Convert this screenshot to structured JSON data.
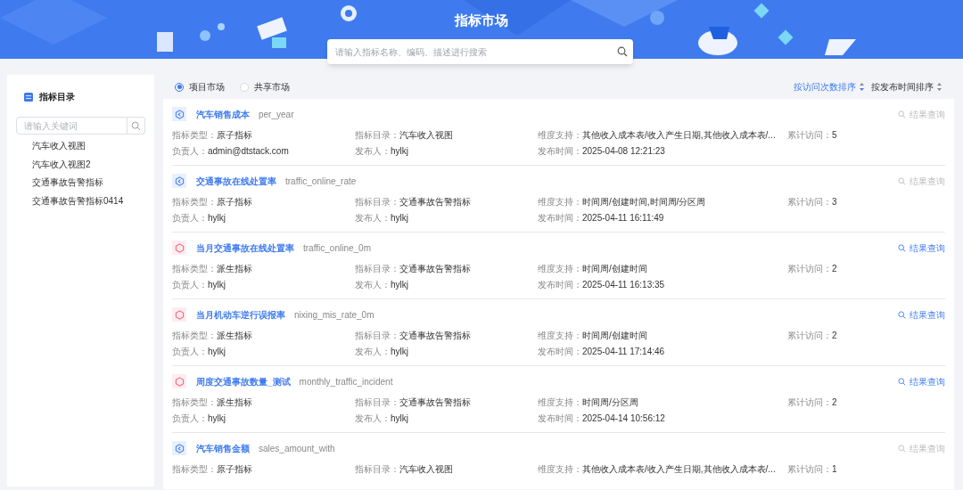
{
  "header": {
    "title": "指标市场",
    "search": {
      "placeholder": "请输入指标名称、编码、描述进行搜索"
    }
  },
  "sidebar": {
    "title": "指标目录",
    "search": {
      "placeholder": "请输入关键词"
    },
    "items": [
      {
        "label": "汽车收入视图"
      },
      {
        "label": "汽车收入视图2"
      },
      {
        "label": "交通事故告警指标"
      },
      {
        "label": "交通事故告警指标0414"
      }
    ]
  },
  "market_tabs": [
    {
      "label": "项目市场",
      "selected": true
    },
    {
      "label": "共享市场",
      "selected": false
    }
  ],
  "sort_options": [
    {
      "label": "按访问次数排序",
      "selected": true
    },
    {
      "label": "按发布时间排序",
      "selected": false
    }
  ],
  "metrics": [
    {
      "kind": "atomic",
      "name": "汽车销售成本",
      "code": "per_year",
      "query": {
        "label": "结果查询",
        "disabled": true
      },
      "fields": [
        {
          "label": "指标类型：",
          "value": "原子指标"
        },
        {
          "label": "指标目录：",
          "value": "汽车收入视图"
        },
        {
          "label": "维度支持：",
          "value": "其他收入成本表/收入产生日期,其他收入成本表/..."
        },
        {
          "label": "累计访问：",
          "value": "5"
        },
        {
          "label": "负责人：",
          "value": "admin@dtstack.com"
        },
        {
          "label": "发布人：",
          "value": "hylkj"
        },
        {
          "label": "发布时间：",
          "value": "2025-04-08 12:21:23"
        }
      ]
    },
    {
      "kind": "atomic",
      "name": "交通事故在线处置率",
      "code": "traffic_online_rate",
      "query": {
        "label": "结果查询",
        "disabled": true
      },
      "fields": [
        {
          "label": "指标类型：",
          "value": "原子指标"
        },
        {
          "label": "指标目录：",
          "value": "交通事故告警指标"
        },
        {
          "label": "维度支持：",
          "value": "时间周/创建时间,时间周/分区周"
        },
        {
          "label": "累计访问：",
          "value": "3"
        },
        {
          "label": "负责人：",
          "value": "hylkj"
        },
        {
          "label": "发布人：",
          "value": "hylkj"
        },
        {
          "label": "发布时间：",
          "value": "2025-04-11 16:11:49"
        }
      ]
    },
    {
      "kind": "derived",
      "name": "当月交通事故在线处置率",
      "code": "traffic_online_0m",
      "query": {
        "label": "结果查询",
        "disabled": false
      },
      "fields": [
        {
          "label": "指标类型：",
          "value": "派生指标"
        },
        {
          "label": "指标目录：",
          "value": "交通事故告警指标"
        },
        {
          "label": "维度支持：",
          "value": "时间周/创建时间"
        },
        {
          "label": "累计访问：",
          "value": "2"
        },
        {
          "label": "负责人：",
          "value": "hylkj"
        },
        {
          "label": "发布人：",
          "value": "hylkj"
        },
        {
          "label": "发布时间：",
          "value": "2025-04-11 16:13:35"
        }
      ]
    },
    {
      "kind": "derived",
      "name": "当月机动车逆行误报率",
      "code": "nixing_mis_rate_0m",
      "query": {
        "label": "结果查询",
        "disabled": false
      },
      "fields": [
        {
          "label": "指标类型：",
          "value": "派生指标"
        },
        {
          "label": "指标目录：",
          "value": "交通事故告警指标"
        },
        {
          "label": "维度支持：",
          "value": "时间周/创建时间"
        },
        {
          "label": "累计访问：",
          "value": "2"
        },
        {
          "label": "负责人：",
          "value": "hylkj"
        },
        {
          "label": "发布人：",
          "value": "hylkj"
        },
        {
          "label": "发布时间：",
          "value": "2025-04-11 17:14:46"
        }
      ]
    },
    {
      "kind": "derived",
      "name": "周度交通事故数量_测试",
      "code": "monthly_traffic_incident",
      "query": {
        "label": "结果查询",
        "disabled": false
      },
      "fields": [
        {
          "label": "指标类型：",
          "value": "派生指标"
        },
        {
          "label": "指标目录：",
          "value": "交通事故告警指标"
        },
        {
          "label": "维度支持：",
          "value": "时间周/分区周"
        },
        {
          "label": "累计访问：",
          "value": "2"
        },
        {
          "label": "负责人：",
          "value": "hylkj"
        },
        {
          "label": "发布人：",
          "value": "hylkj"
        },
        {
          "label": "发布时间：",
          "value": "2025-04-14 10:56:12"
        }
      ]
    },
    {
      "kind": "atomic",
      "name": "汽车销售金额",
      "code": "sales_amount_with",
      "query": {
        "label": "结果查询",
        "disabled": true
      },
      "fields": [
        {
          "label": "指标类型：",
          "value": "原子指标"
        },
        {
          "label": "指标目录：",
          "value": "汽车收入视图"
        },
        {
          "label": "维度支持：",
          "value": "其他收入成本表/收入产生日期,其他收入成本表/..."
        },
        {
          "label": "累计访问：",
          "value": "1"
        }
      ]
    }
  ]
}
